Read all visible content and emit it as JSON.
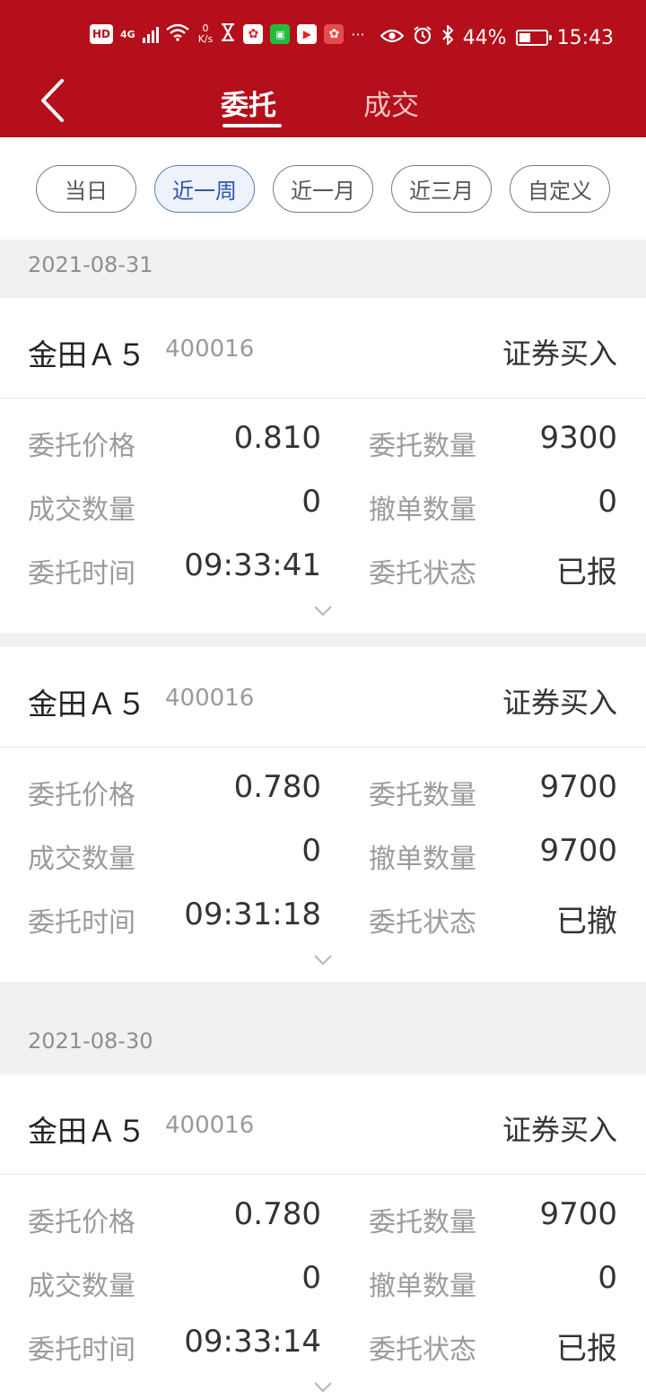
{
  "status_bar": {
    "hd": "HD",
    "network": "4G",
    "net_speed_value": "0",
    "net_speed_unit": "K/s",
    "more": "···",
    "battery": "44%",
    "battery_level": 0.44,
    "time": "15:43"
  },
  "header": {
    "tabs": [
      {
        "label": "委托",
        "active": true
      },
      {
        "label": "成交",
        "active": false
      }
    ]
  },
  "filters": [
    {
      "label": "当日",
      "active": false
    },
    {
      "label": "近一周",
      "active": true
    },
    {
      "label": "近一月",
      "active": false
    },
    {
      "label": "近三月",
      "active": false
    },
    {
      "label": "自定义",
      "active": false
    }
  ],
  "groups": [
    {
      "date": "2021-08-31",
      "orders": [
        {
          "name": "金田Ａ５",
          "code": "400016",
          "type": "证券买入",
          "price_label": "委托价格",
          "price": "0.810",
          "qty_label": "委托数量",
          "qty": "9300",
          "filled_label": "成交数量",
          "filled": "0",
          "cancel_label": "撤单数量",
          "cancel": "0",
          "time_label": "委托时间",
          "time": "09:33:41",
          "status_label": "委托状态",
          "status": "已报"
        },
        {
          "name": "金田Ａ５",
          "code": "400016",
          "type": "证券买入",
          "price_label": "委托价格",
          "price": "0.780",
          "qty_label": "委托数量",
          "qty": "9700",
          "filled_label": "成交数量",
          "filled": "0",
          "cancel_label": "撤单数量",
          "cancel": "9700",
          "time_label": "委托时间",
          "time": "09:31:18",
          "status_label": "委托状态",
          "status": "已撤"
        }
      ]
    },
    {
      "date": "2021-08-30",
      "orders": [
        {
          "name": "金田Ａ５",
          "code": "400016",
          "type": "证券买入",
          "price_label": "委托价格",
          "price": "0.780",
          "qty_label": "委托数量",
          "qty": "9700",
          "filled_label": "成交数量",
          "filled": "0",
          "cancel_label": "撤单数量",
          "cancel": "0",
          "time_label": "委托时间",
          "time": "09:33:14",
          "status_label": "委托状态",
          "status": "已报"
        }
      ]
    }
  ],
  "colors": {
    "header_bg": "#b40f1a",
    "active_filter": "#2e57ad",
    "separator_bg": "#f1f1f1"
  }
}
